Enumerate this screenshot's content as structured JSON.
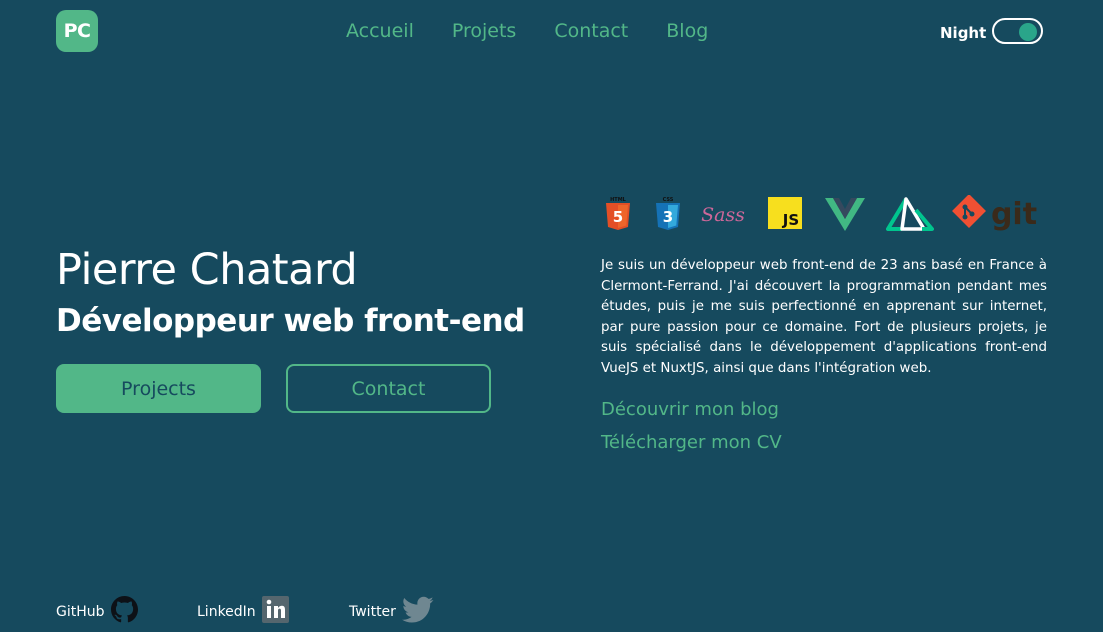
{
  "header": {
    "logo_text": "PC",
    "nav": [
      "Accueil",
      "Projets",
      "Contact",
      "Blog"
    ],
    "theme_label": "Night",
    "theme_toggle_on": true
  },
  "hero": {
    "name": "Pierre Chatard",
    "role": "Développeur web front-end",
    "primary_button": "Projects",
    "secondary_button": "Contact"
  },
  "about": {
    "technologies": [
      "HTML5",
      "CSS3",
      "Sass",
      "JavaScript",
      "Vue.js",
      "Nuxt.js",
      "git"
    ],
    "tech_labels": {
      "html": "HTML",
      "css": "CSS",
      "sass": "Sass",
      "js": "JS",
      "git": "git"
    },
    "bio": "Je suis un développeur web front-end de 23 ans basé en France à Clermont-Ferrand. J'ai découvert la programmation pendant mes études, puis je me suis perfectionné en apprenant sur internet, par pure passion pour ce domaine. Fort de plusieurs projets, je suis spécialisé dans le développement d'applications front-end VueJS et NuxtJS, ainsi que dans l'intégration web.",
    "blog_link": "Découvrir mon blog",
    "cv_link": "Télécharger mon CV"
  },
  "social": [
    {
      "label": "GitHub",
      "icon": "github-icon"
    },
    {
      "label": "LinkedIn",
      "icon": "linkedin-icon"
    },
    {
      "label": "Twitter",
      "icon": "twitter-icon"
    }
  ],
  "colors": {
    "background": "#164a5e",
    "accent": "#52b788",
    "text": "#ffffff"
  }
}
